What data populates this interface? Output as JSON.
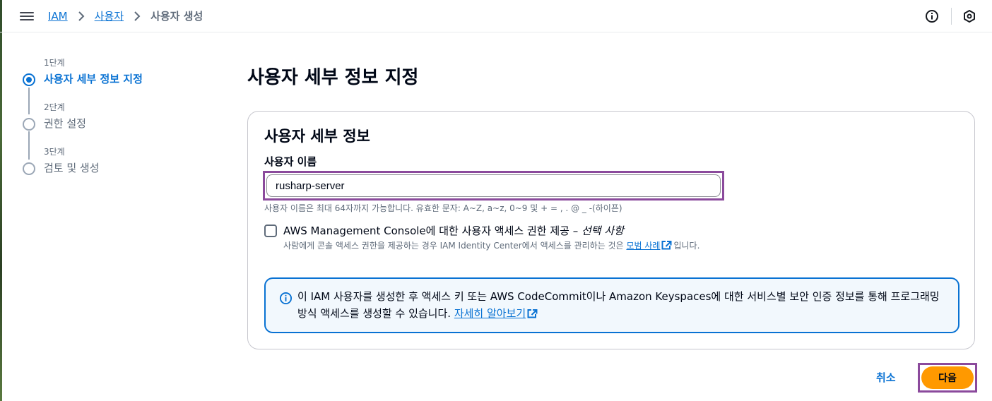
{
  "header": {
    "breadcrumbs": [
      {
        "label": "IAM"
      },
      {
        "label": "사용자"
      }
    ],
    "current": "사용자 생성",
    "icons": [
      "menu-icon",
      "info-icon",
      "hexagon-icon"
    ]
  },
  "steps": [
    {
      "number": "1단계",
      "title": "사용자 세부 정보 지정",
      "active": true
    },
    {
      "number": "2단계",
      "title": "권한 설정",
      "active": false
    },
    {
      "number": "3단계",
      "title": "검토 및 생성",
      "active": false
    }
  ],
  "main": {
    "page_title": "사용자 세부 정보 지정",
    "section_title": "사용자 세부 정보",
    "username_label": "사용자 이름",
    "username_value": "rusharp-server",
    "username_constraint": "사용자 이름은 최대 64자까지 가능합니다. 유효한 문자: A~Z, a~z, 0~9 및 + = , . @ _ -(하이픈)",
    "console_access": {
      "label": "AWS Management Console에 대한 사용자 액세스 권한 제공 – ",
      "label_optional": "선택 사항",
      "checked": false,
      "desc_prefix": "사람에게 콘솔 액세스 권한을 제공하는 경우 IAM Identity Center에서 액세스를 관리하는 것은 ",
      "desc_link": "모범 사례",
      "desc_suffix": "입니다."
    },
    "info_alert": {
      "text": "이 IAM 사용자를 생성한 후 액세스 키 또는 AWS CodeCommit이나 Amazon Keyspaces에 대한 서비스별 보안 인증 정보를 통해 프로그래밍 방식 액세스를 생성할 수 있습니다. ",
      "link": "자세히 알아보기"
    }
  },
  "footer": {
    "cancel_label": "취소",
    "next_label": "다음"
  },
  "colors": {
    "accent": "#0972d3",
    "primary_button": "#ff9900",
    "highlight": "#8b4a9c"
  }
}
